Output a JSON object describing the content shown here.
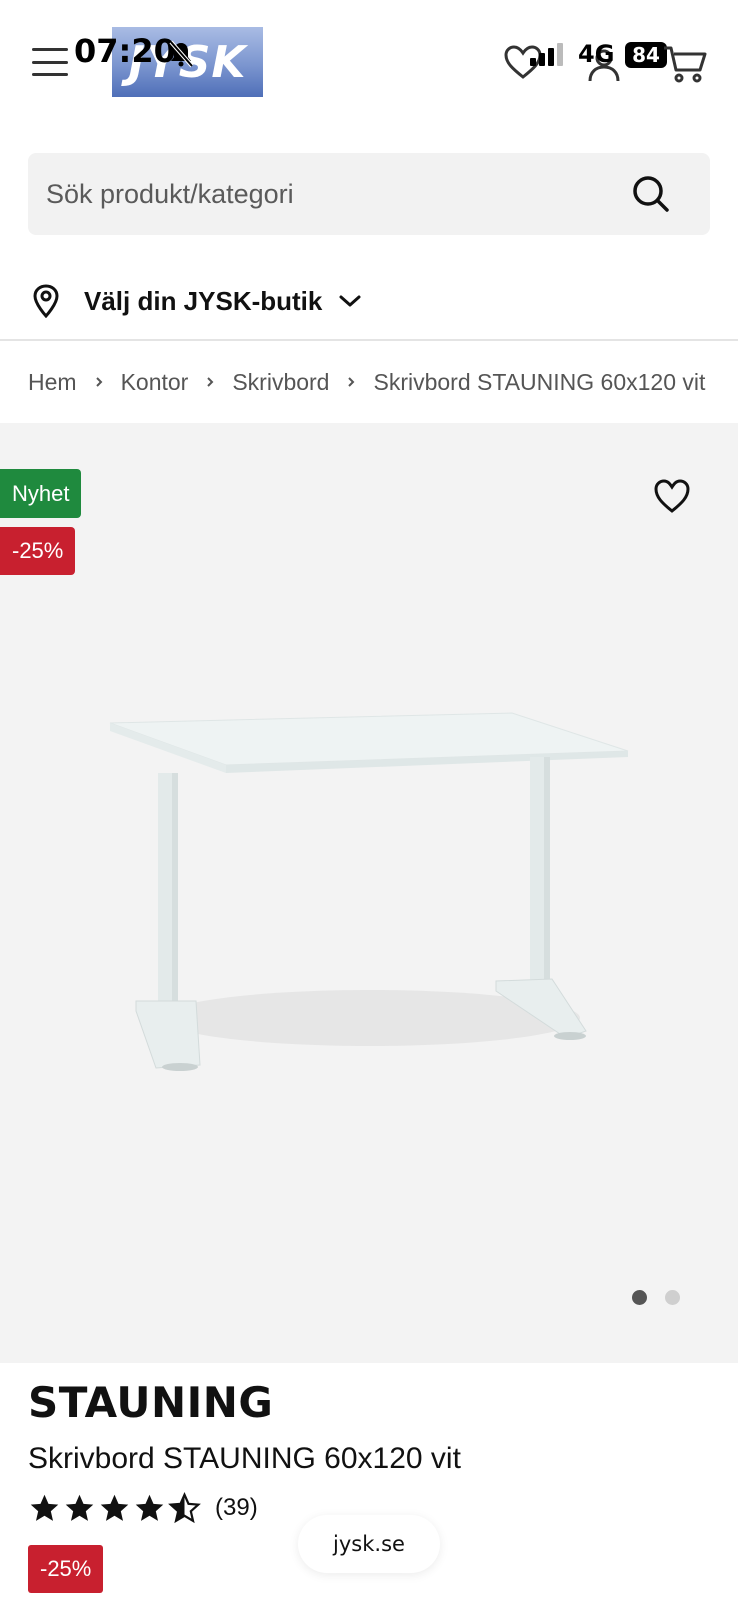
{
  "status_bar": {
    "time": "07:20",
    "network": "4G",
    "battery": "84"
  },
  "header": {
    "logo_text": "JYSK",
    "menu_icon": "hamburger-menu-icon",
    "wishlist_icon": "heart-icon",
    "account_icon": "user-icon",
    "cart_icon": "shopping-cart-icon"
  },
  "search": {
    "placeholder": "Sök produkt/kategori",
    "icon": "search-icon"
  },
  "store": {
    "label": "Välj din JYSK-butik",
    "icon": "location-pin-icon"
  },
  "breadcrumb": {
    "items": [
      "Hem",
      "Kontor",
      "Skrivbord",
      "Skrivbord STAUNING 60x120 vit"
    ]
  },
  "gallery": {
    "badge_new": "Nyhet",
    "badge_discount": "-25%",
    "wishlist_icon": "heart-outline-icon",
    "image_count": 2,
    "active_image_index": 0
  },
  "product": {
    "brand": "STAUNING",
    "title": "Skrivbord STAUNING 60x120 vit",
    "rating": 4.5,
    "rating_count": "(39)",
    "discount": "-25%"
  },
  "browser": {
    "url": "jysk.se"
  },
  "colors": {
    "accent_green": "#1f8a3e",
    "accent_red": "#c8202f",
    "logo_blue": "#4f6fb8",
    "gallery_bg": "#f3f3f3"
  }
}
